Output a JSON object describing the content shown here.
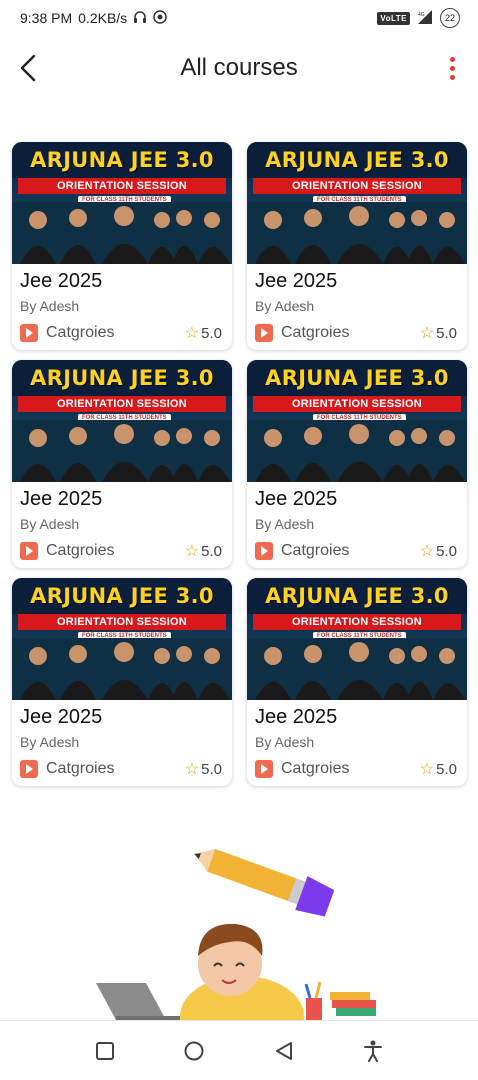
{
  "status_bar": {
    "time": "9:38 PM",
    "speed": "0.2KB/s",
    "network_badge": "VoLTE",
    "network_type": "4G",
    "battery": "22"
  },
  "header": {
    "title": "All courses"
  },
  "courses": [
    {
      "thumb_title": "ARJUNA JEE 3.0",
      "thumb_subtitle": "ORIENTATION SESSION",
      "thumb_tag": "FOR CLASS 11TH STUDENTS",
      "title": "Jee 2025",
      "author": "By Adesh",
      "category": "Catgroies",
      "rating": "5.0"
    },
    {
      "thumb_title": "ARJUNA JEE 3.0",
      "thumb_subtitle": "ORIENTATION SESSION",
      "thumb_tag": "FOR CLASS 11TH STUDENTS",
      "title": "Jee 2025",
      "author": "By Adesh",
      "category": "Catgroies",
      "rating": "5.0"
    },
    {
      "thumb_title": "ARJUNA JEE 3.0",
      "thumb_subtitle": "ORIENTATION SESSION",
      "thumb_tag": "FOR CLASS 11TH STUDENTS",
      "title": "Jee 2025",
      "author": "By Adesh",
      "category": "Catgroies",
      "rating": "5.0"
    },
    {
      "thumb_title": "ARJUNA JEE 3.0",
      "thumb_subtitle": "ORIENTATION SESSION",
      "thumb_tag": "FOR CLASS 11TH STUDENTS",
      "title": "Jee 2025",
      "author": "By Adesh",
      "category": "Catgroies",
      "rating": "5.0"
    },
    {
      "thumb_title": "ARJUNA JEE 3.0",
      "thumb_subtitle": "ORIENTATION SESSION",
      "thumb_tag": "FOR CLASS 11TH STUDENTS",
      "title": "Jee 2025",
      "author": "By Adesh",
      "category": "Catgroies",
      "rating": "5.0"
    },
    {
      "thumb_title": "ARJUNA JEE 3.0",
      "thumb_subtitle": "ORIENTATION SESSION",
      "thumb_tag": "FOR CLASS 11TH STUDENTS",
      "title": "Jee 2025",
      "author": "By Adesh",
      "category": "Catgroies",
      "rating": "5.0"
    }
  ],
  "icons": {
    "back": "arrow-left-icon",
    "menu": "more-vertical-icon",
    "category": "play-folder-icon",
    "rating": "star-icon",
    "nav_recent": "square-icon",
    "nav_home": "circle-icon",
    "nav_back": "triangle-back-icon",
    "nav_accessibility": "accessibility-icon"
  },
  "colors": {
    "accent_red": "#e53935",
    "thumb_yellow": "#ffd21f",
    "thumb_banner_red": "#d7191c",
    "star": "#e0a400",
    "category_icon": "#f06a4f"
  }
}
